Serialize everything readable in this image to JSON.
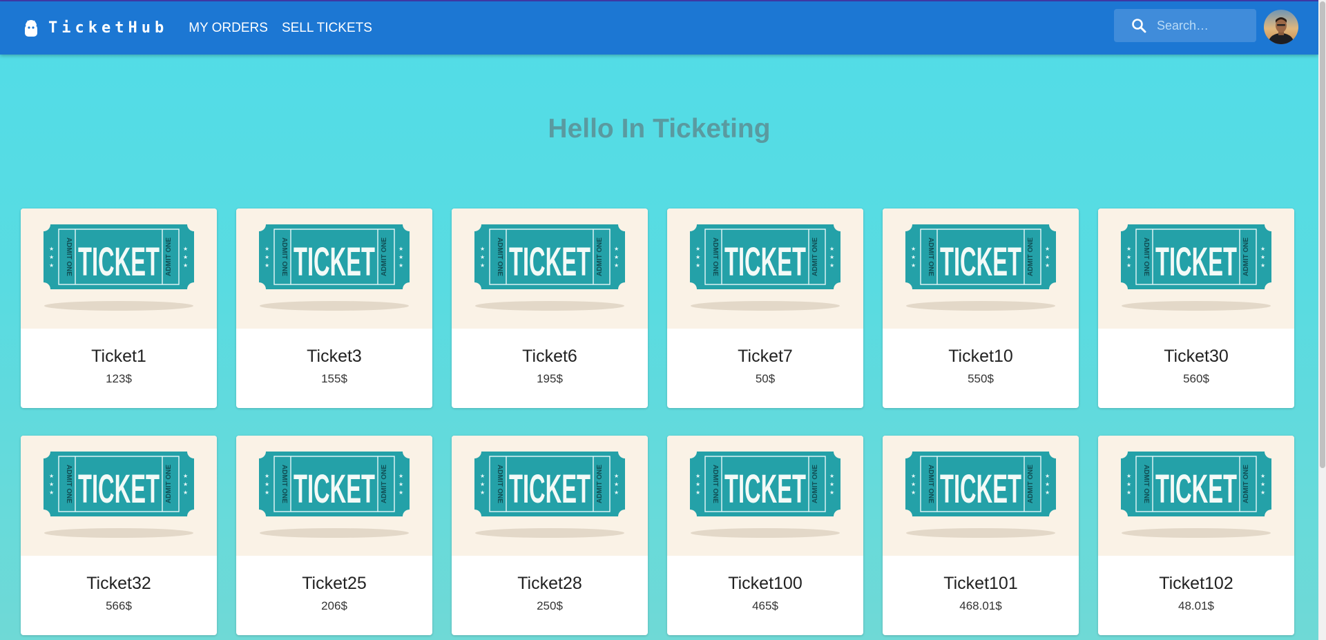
{
  "app": {
    "brand": "TicketHub"
  },
  "nav": [
    {
      "label": "MY ORDERS"
    },
    {
      "label": "SELL TICKETS"
    }
  ],
  "search": {
    "placeholder": "Search…",
    "icon": "search-icon"
  },
  "page": {
    "title": "Hello In Ticketing"
  },
  "ticket_image": {
    "main": "TICKET",
    "side": "ADMIT ONE"
  },
  "tickets": [
    {
      "name": "Ticket1",
      "price": "123$"
    },
    {
      "name": "Ticket3",
      "price": "155$"
    },
    {
      "name": "Ticket6",
      "price": "195$"
    },
    {
      "name": "Ticket7",
      "price": "50$"
    },
    {
      "name": "Ticket10",
      "price": "550$"
    },
    {
      "name": "Ticket30",
      "price": "560$"
    },
    {
      "name": "Ticket32",
      "price": "566$"
    },
    {
      "name": "Ticket25",
      "price": "206$"
    },
    {
      "name": "Ticket28",
      "price": "250$"
    },
    {
      "name": "Ticket100",
      "price": "465$"
    },
    {
      "name": "Ticket101",
      "price": "468.01$"
    },
    {
      "name": "Ticket102",
      "price": "48.01$"
    }
  ],
  "colors": {
    "appbar": "#1c77d3",
    "background": "#51dde8",
    "ticket_teal": "#24a1a8",
    "ticket_cream": "#faf2e6",
    "title": "#5a9aa0"
  }
}
